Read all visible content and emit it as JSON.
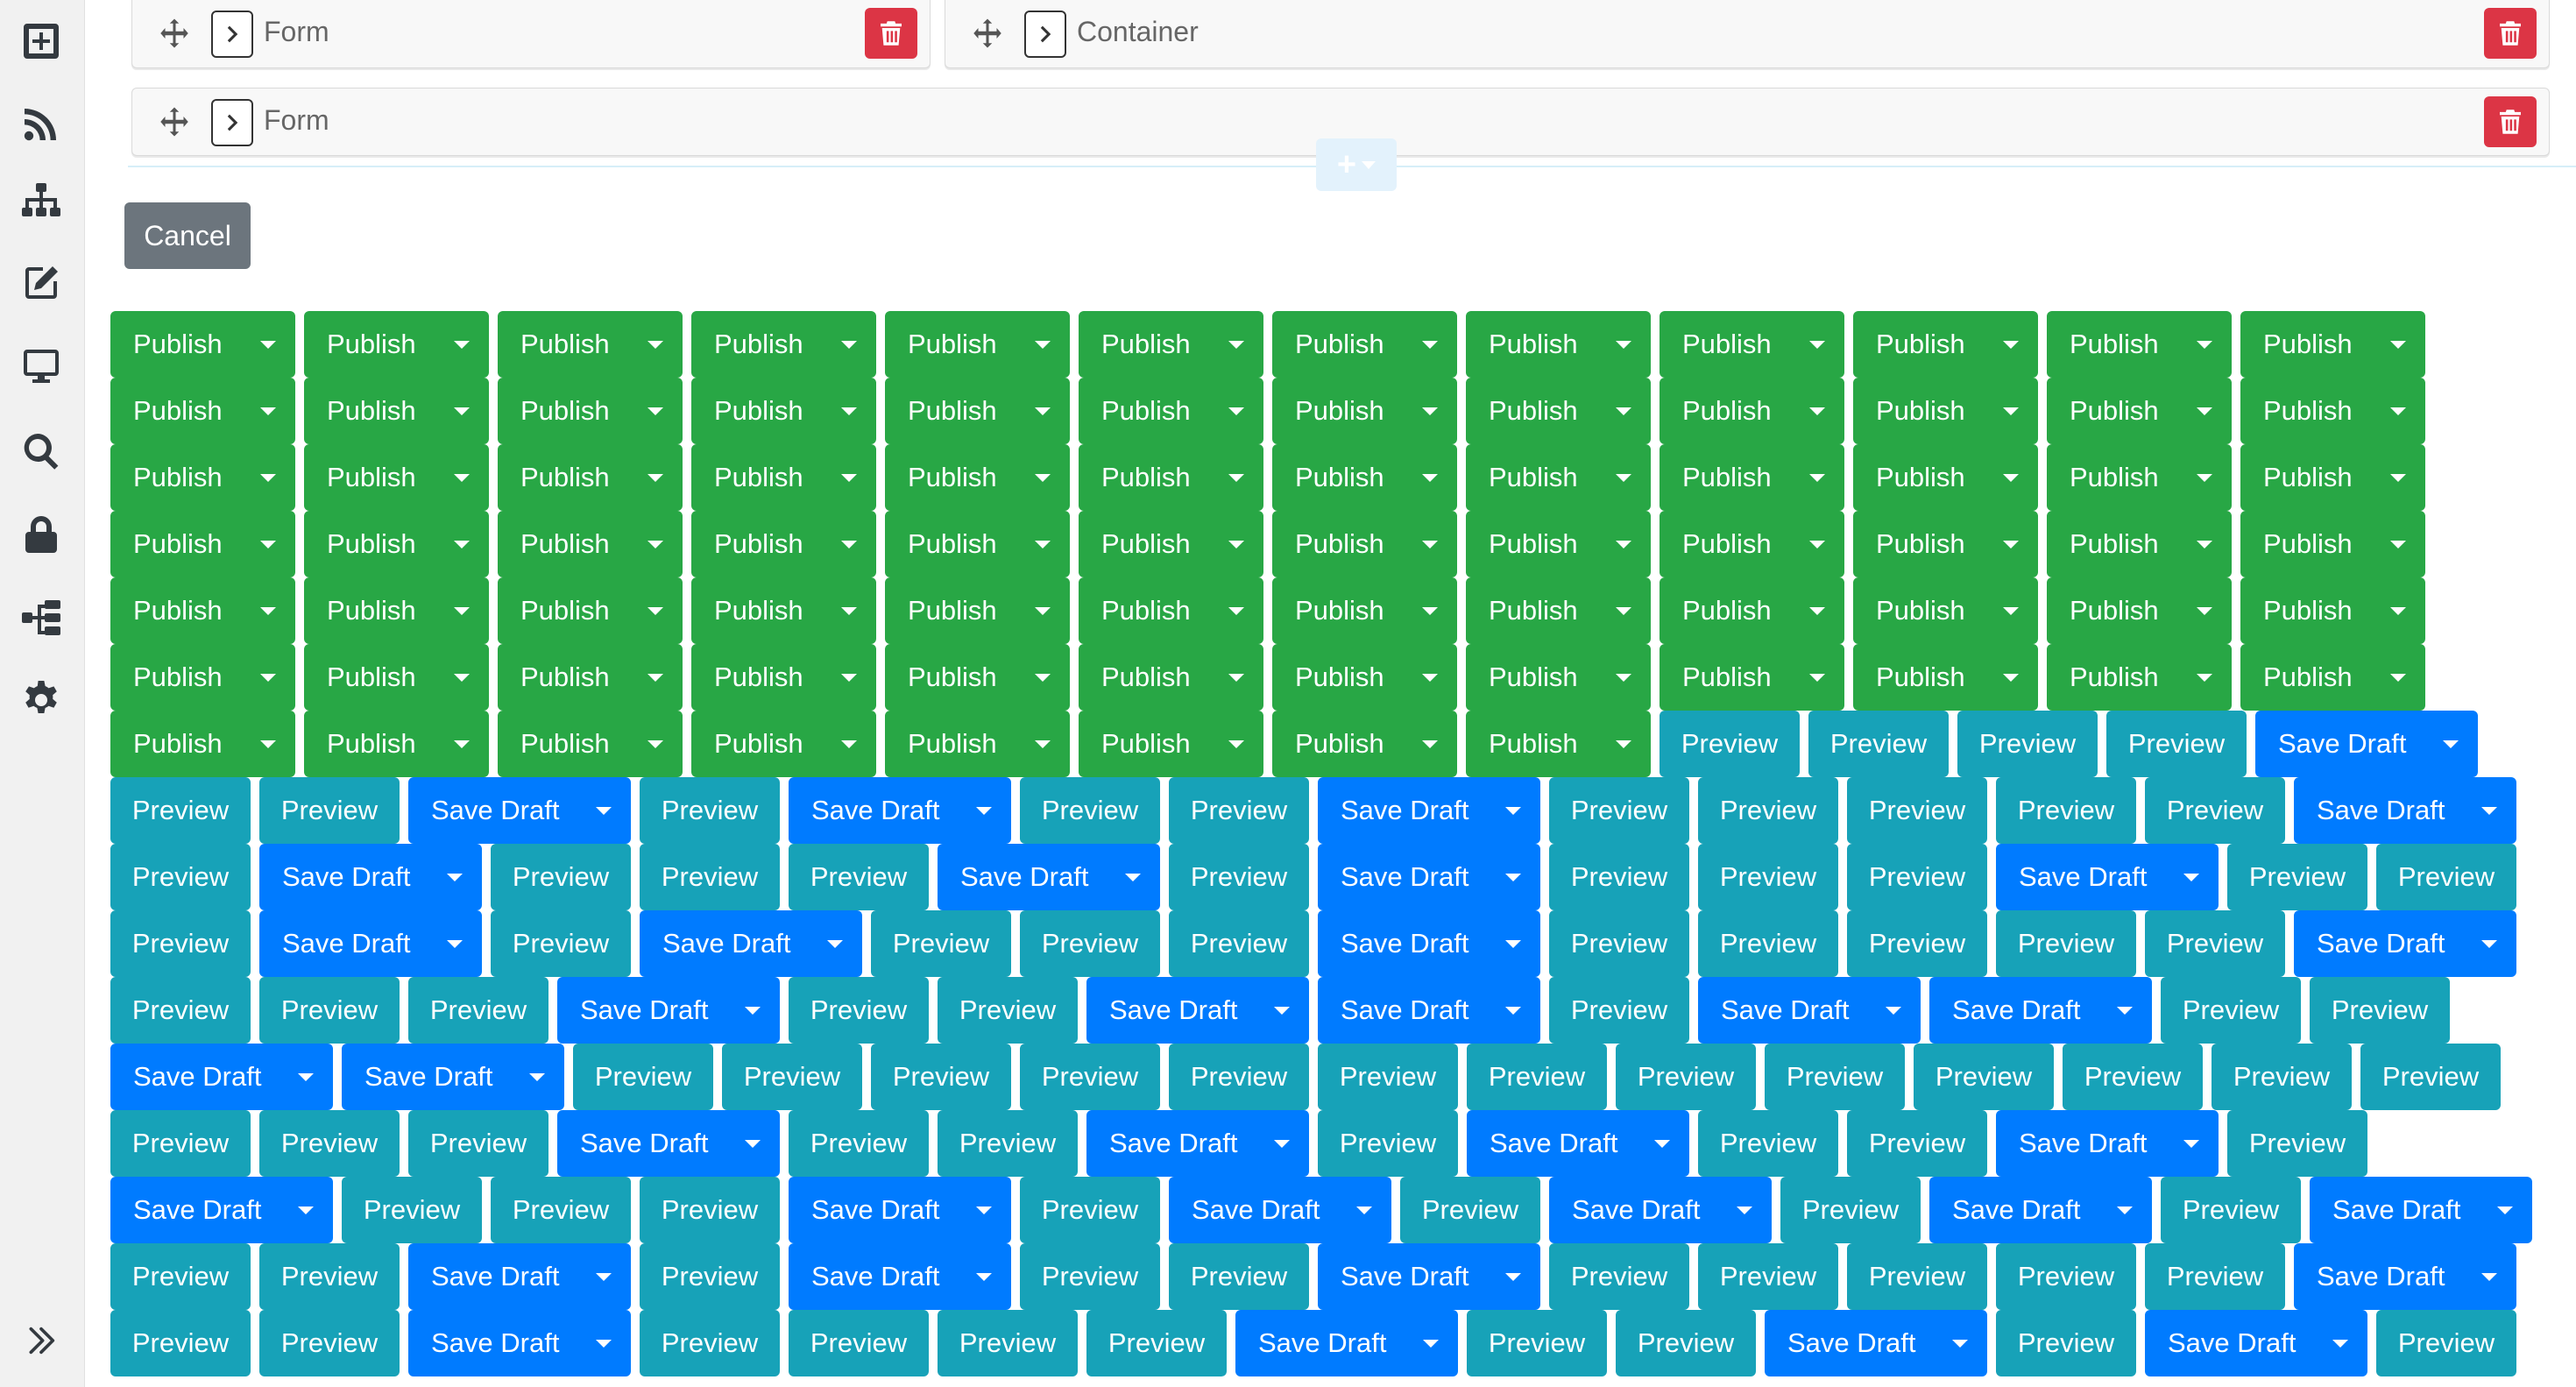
{
  "sidebar": {
    "icons": [
      "add-square-icon",
      "rss-icon",
      "sitemap-icon",
      "edit-icon",
      "desktop-icon",
      "search-icon",
      "lock-icon",
      "tree-icon",
      "gear-icon"
    ],
    "expand_icon": "double-chevron-right-icon"
  },
  "components": [
    {
      "label": "Form"
    },
    {
      "label": "Container"
    },
    {
      "label": "Form"
    }
  ],
  "add_component": {
    "symbol": "+"
  },
  "cancel": {
    "label": "Cancel"
  },
  "buttons": {
    "labels": {
      "publish": "Publish",
      "draft": "Save Draft",
      "preview": "Preview"
    },
    "sequence": "PPPPPPPPPPPPPPPPPPPPPPPPPPPPPPPPPPPPPPPPPPPPPPPPPPPPPPPPPPPPPPPPPPPPPPPPPPPPPPPPVVVVDVVDVDVVDVVVVVDVDVVVDVDVVVDVVVDVDVVVDVVVVVDVVVDVVDDVDDVVDDVVVVVVVVVVVVVVVVDVVDVDVVDVDVVVDVDVDVDVDVVDVDVVDVVVVVDVVDVVVVDVVDVDV"
  },
  "colors": {
    "publish": "#28a745",
    "save_draft": "#007bff",
    "preview": "#17a2b8",
    "cancel": "#6c757d",
    "delete": "#dc3545"
  }
}
